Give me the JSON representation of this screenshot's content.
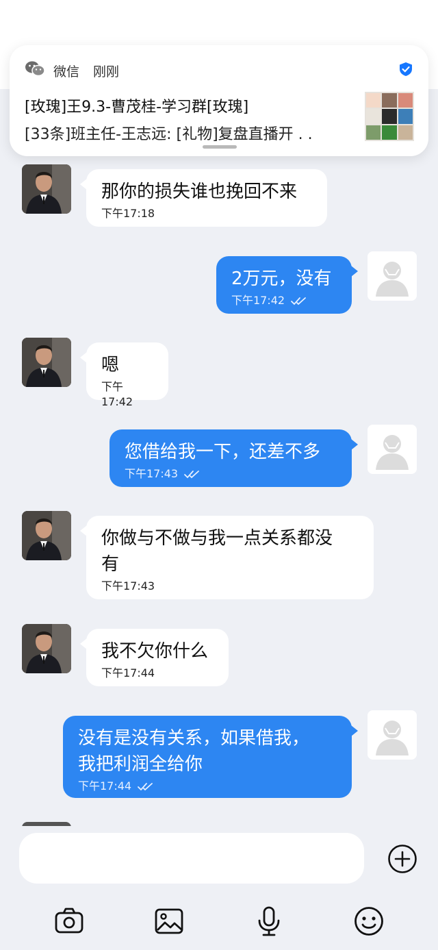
{
  "notification": {
    "app": "微信",
    "time": "刚刚",
    "title": "[玫瑰]王9.3-曹茂桂-学习群[玫瑰]",
    "body": "[33条]班主任-王志远: [礼物]复盘直播开 . .",
    "icon": "wechat-icon",
    "badge_icon": "verified-shield-icon",
    "accent_color": "#1677ff"
  },
  "messages": [
    {
      "side": "in",
      "lines": [
        "那你的损失谁也挽回不来"
      ],
      "time": "下午17:18"
    },
    {
      "side": "out",
      "lines": [
        "2万元，没有"
      ],
      "time": "下午17:42"
    },
    {
      "side": "in",
      "lines": [
        "嗯"
      ],
      "time": "下午17:42"
    },
    {
      "side": "out",
      "lines": [
        "您借给我一下，还差不多"
      ],
      "time": "下午17:43"
    },
    {
      "side": "in",
      "lines": [
        "你做与不做与我一点关系都没",
        "有"
      ],
      "time": "下午17:43"
    },
    {
      "side": "in",
      "lines": [
        "我不欠你什么"
      ],
      "time": "下午17:44"
    },
    {
      "side": "out",
      "lines": [
        "没有是没有关系，如果借我，",
        "我把利润全给你"
      ],
      "time": "下午17:44"
    }
  ],
  "composer": {
    "placeholder": "",
    "plus_icon": "plus-circle-icon",
    "tools": [
      "camera-icon",
      "image-icon",
      "microphone-icon",
      "emoji-icon"
    ]
  },
  "colors": {
    "outgoing_bubble": "#2d86f2",
    "incoming_bubble": "#ffffff",
    "background": "#eef0f5"
  }
}
